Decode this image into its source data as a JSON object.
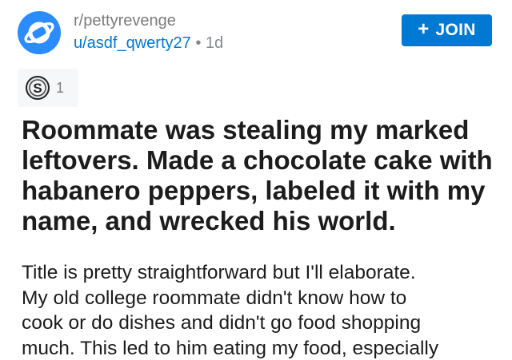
{
  "post": {
    "subreddit": "r/pettyrevenge",
    "username": "u/asdf_qwerty27",
    "separator": "•",
    "age": "1d",
    "join_label": "JOIN",
    "join_icon": "plus-icon",
    "award_icon": "silver-award-icon",
    "award_count": "1",
    "title_lines": [
      "Roommate was stealing my marked",
      "leftovers. Made a chocolate cake with",
      "habanero peppers, labeled it with my",
      "name, and wrecked his world."
    ],
    "body_lines": [
      "Title is pretty straightforward but I'll elaborate.",
      "My old college roommate didn't know how to",
      "cook or do dishes and didn't go food shopping",
      "much. This led to him eating my food, especially"
    ]
  },
  "colors": {
    "accent": "#0079d3",
    "avatar_bg": "#2a8cff",
    "meta_gray": "#7c7c7c",
    "text": "#1c1c1c",
    "award_bg": "#f6f7f8"
  }
}
